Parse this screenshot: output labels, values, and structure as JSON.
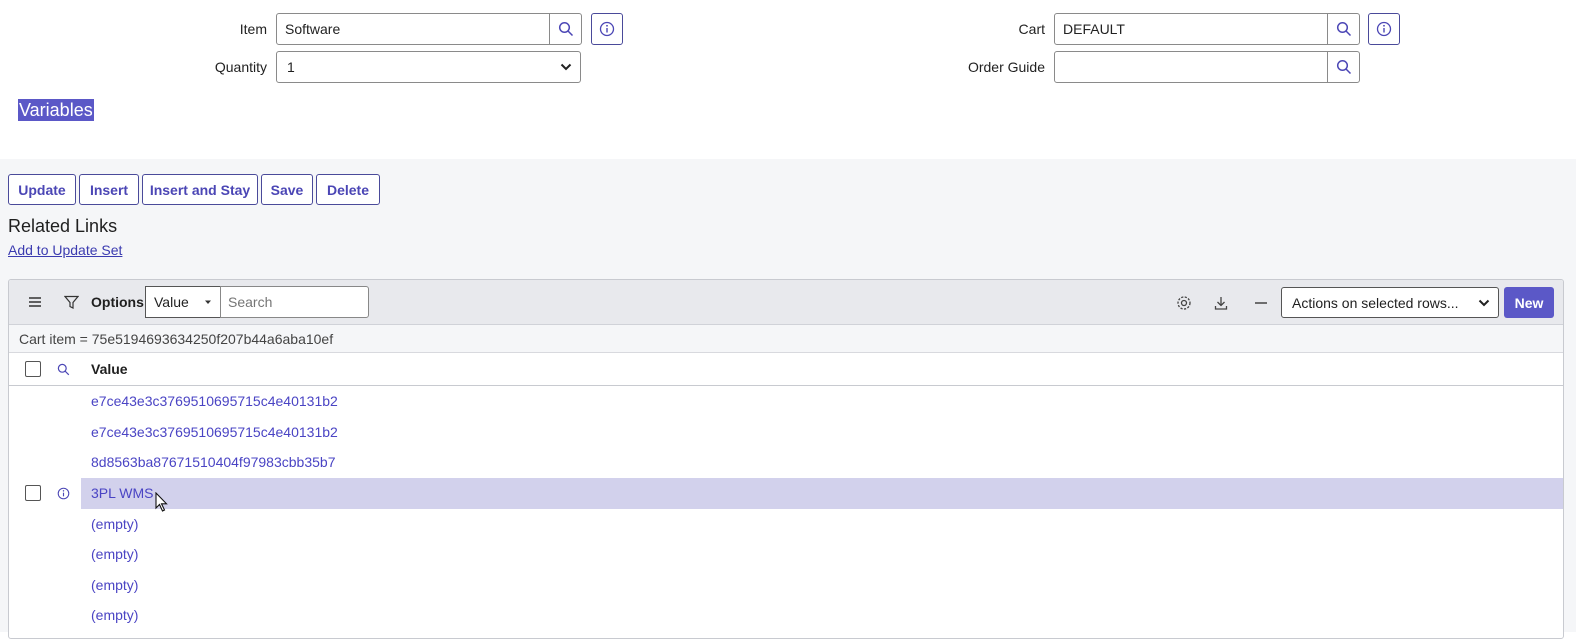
{
  "form": {
    "item_label": "Item",
    "item_value": "Software",
    "quantity_label": "Quantity",
    "quantity_value": "1",
    "cart_label": "Cart",
    "cart_value": "DEFAULT",
    "order_guide_label": "Order Guide",
    "order_guide_value": ""
  },
  "section": {
    "variables_heading": "Variables"
  },
  "actions": {
    "update": "Update",
    "insert": "Insert",
    "insert_and_stay": "Insert and Stay",
    "save": "Save",
    "delete": "Delete"
  },
  "related_links": {
    "title": "Related Links",
    "add_to_update_set": "Add to Update Set"
  },
  "list": {
    "options_label": "Options",
    "search_field": "Value",
    "search_placeholder": "Search",
    "actions_select": "Actions on selected rows...",
    "new_button": "New",
    "breadcrumb": "Cart item = 75e5194693634250f207b44a6aba10ef",
    "column_value": "Value",
    "rows": [
      {
        "value": "e7ce43e3c3769510695715c4e40131b2"
      },
      {
        "value": "e7ce43e3c3769510695715c4e40131b2"
      },
      {
        "value": "8d8563ba87671510404f97983cbb35b7"
      },
      {
        "value": "3PL WMS"
      },
      {
        "value": "(empty)"
      },
      {
        "value": "(empty)"
      },
      {
        "value": "(empty)"
      },
      {
        "value": "(empty)"
      }
    ]
  },
  "colors": {
    "accent": "#5b58c7",
    "link": "#4a44c4",
    "highlight_row": "#d2d1ec"
  }
}
